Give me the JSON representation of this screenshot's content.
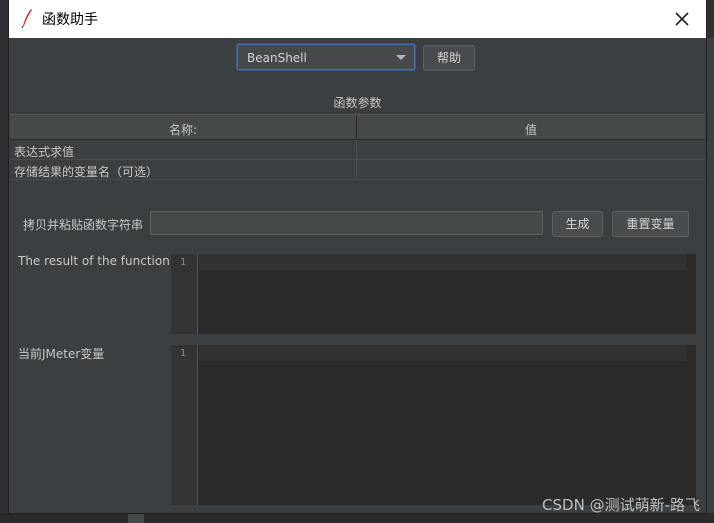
{
  "window": {
    "title": "函数助手"
  },
  "function_select": {
    "value": "BeanShell"
  },
  "help_button": {
    "label": "帮助"
  },
  "params": {
    "section_title": "函数参数",
    "columns": [
      "名称:",
      "值"
    ],
    "rows": [
      {
        "name": "表达式求值",
        "value": ""
      },
      {
        "name": "存储结果的变量名（可选）",
        "value": ""
      }
    ]
  },
  "function_string": {
    "label": "拷贝并粘贴函数字符串",
    "value": "",
    "generate_label": "生成",
    "reset_label": "重置变量"
  },
  "result": {
    "label": "The result of the function is",
    "line": "1"
  },
  "jmeter_vars": {
    "label": "当前JMeter变量",
    "line": "1"
  },
  "watermark": "CSDN @测试萌新-路飞"
}
